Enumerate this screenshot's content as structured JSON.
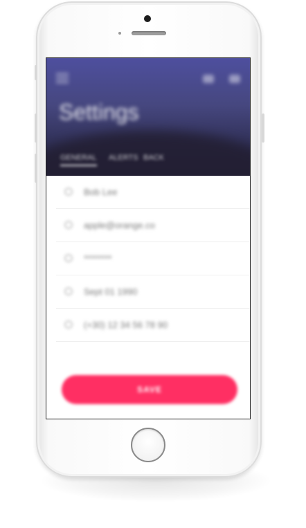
{
  "screen": {
    "header": {
      "title": "Settings",
      "tabs": [
        {
          "label": "GENERAL",
          "active": true
        },
        {
          "label": "ALERTS",
          "active": false
        },
        {
          "label": "BACK",
          "active": false
        }
      ]
    },
    "form": {
      "fields": [
        {
          "icon": "user-icon",
          "value": "Bob Lee"
        },
        {
          "icon": "mail-icon",
          "value": "apple@orange.co"
        },
        {
          "icon": "lock-icon",
          "value": "********"
        },
        {
          "icon": "calendar-icon",
          "value": "Sept 01 1990"
        },
        {
          "icon": "phone-icon",
          "value": "(+30) 12 34 56 78 90"
        }
      ],
      "submit_label": "SAVE"
    }
  },
  "colors": {
    "header_top": "#4e4f9e",
    "header_bottom": "#1f1f35",
    "accent": "#ff2f63"
  }
}
